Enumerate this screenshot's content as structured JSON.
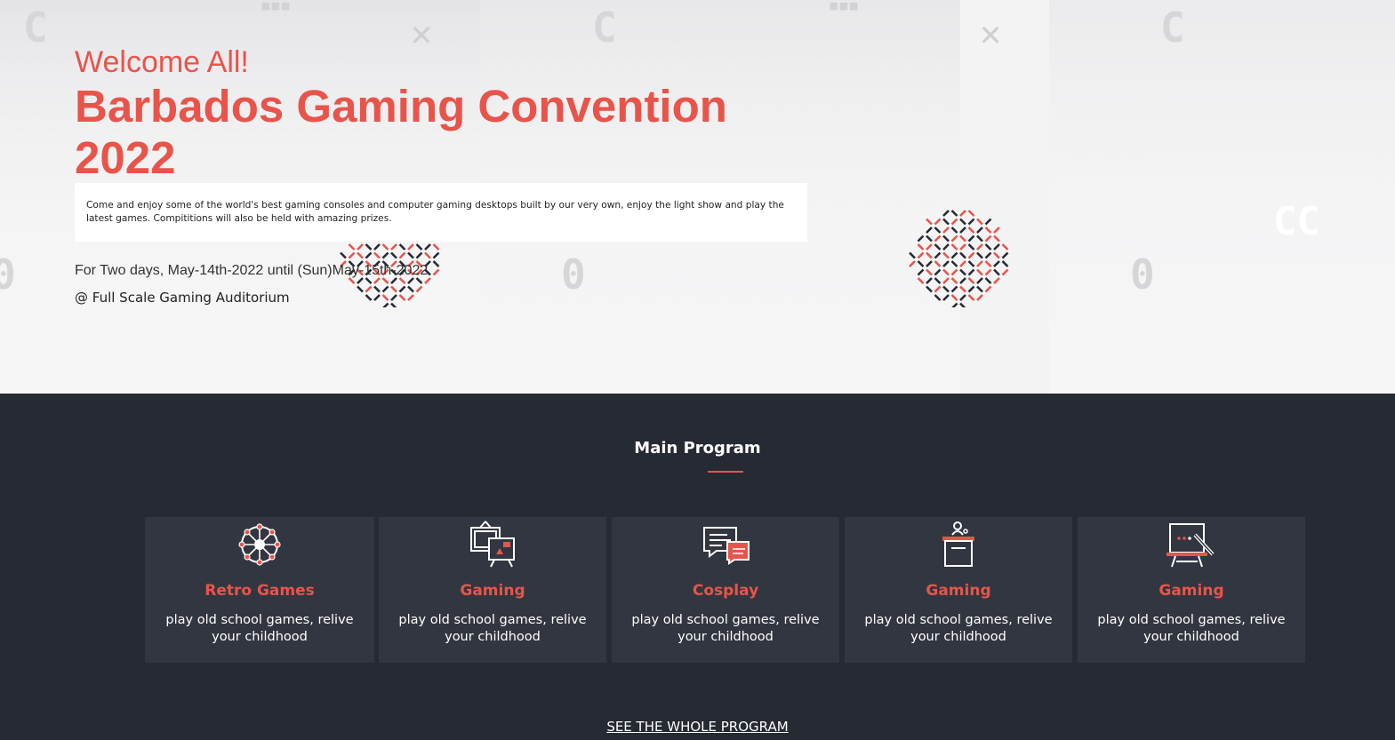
{
  "hero": {
    "welcome": "Welcome All!",
    "title": "Barbados Gaming Convention 2022",
    "description": "Come and enjoy some of the world's best gaming consoles and computer gaming desktops built by our very own, enjoy the light show and play the latest games. Compititions will also be held with amazing prizes.",
    "dates": "For Two days, May-14th-2022 until (Sun)May-15th-2022",
    "venue": "@ Full Scale Gaming Auditorium"
  },
  "program": {
    "title": "Main Program",
    "cards": [
      {
        "icon": "ferris-wheel-icon",
        "title": "Retro Games",
        "description": "play old school games, relive your childhood"
      },
      {
        "icon": "tv-easel-icon",
        "title": "Gaming",
        "description": "play old school games, relive your childhood"
      },
      {
        "icon": "chat-bubbles-icon",
        "title": "Cosplay",
        "description": "play old school games, relive your childhood"
      },
      {
        "icon": "podium-icon",
        "title": "Gaming",
        "description": "play old school games, relive your childhood"
      },
      {
        "icon": "whiteboard-icon",
        "title": "Gaming",
        "description": "play old school games, relive your childhood"
      }
    ],
    "see_all": "SEE THE WHOLE PROGRAM"
  },
  "colors": {
    "accent": "#e9544a",
    "dark_bg": "#262a33",
    "card_bg": "#323640"
  }
}
